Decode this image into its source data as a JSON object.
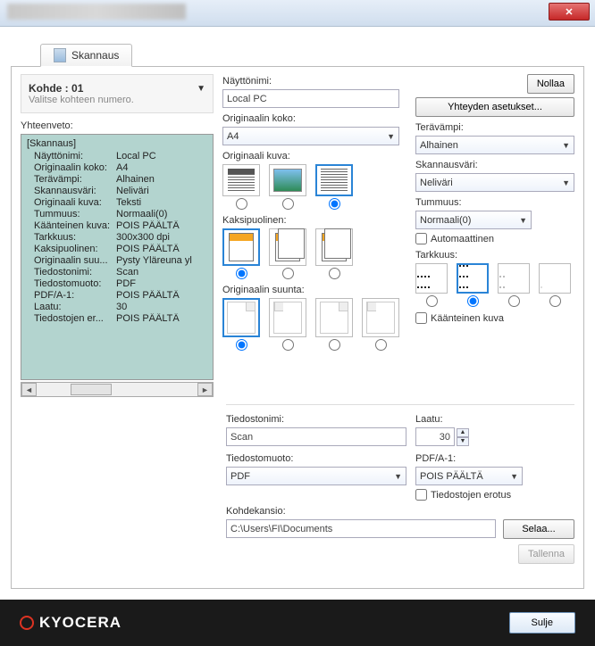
{
  "window": {
    "close_label": "✕"
  },
  "tab": {
    "label": "Skannaus"
  },
  "kohde": {
    "label": "Kohde :",
    "value": "01",
    "hint": "Valitse kohteen numero."
  },
  "summary": {
    "label": "Yhteenveto:",
    "header": "[Skannaus]",
    "rows": [
      {
        "key": "Näyttönimi:",
        "val": "Local PC"
      },
      {
        "key": "Originaalin koko:",
        "val": "A4"
      },
      {
        "key": "Terävämpi:",
        "val": "Alhainen"
      },
      {
        "key": "Skannausväri:",
        "val": "Neliväri"
      },
      {
        "key": "Originaali kuva:",
        "val": "Teksti"
      },
      {
        "key": "Tummuus:",
        "val": "Normaali(0)"
      },
      {
        "key": "Käänteinen kuva:",
        "val": "POIS PÄÄLTÄ"
      },
      {
        "key": "Tarkkuus:",
        "val": "300x300 dpi"
      },
      {
        "key": "Kaksipuolinen:",
        "val": "POIS PÄÄLTÄ"
      },
      {
        "key": "Originaalin suu...",
        "val": "Pysty Yläreuna yl"
      },
      {
        "key": "Tiedostonimi:",
        "val": "Scan"
      },
      {
        "key": "Tiedostomuoto:",
        "val": "PDF"
      },
      {
        "key": "PDF/A-1:",
        "val": "POIS PÄÄLTÄ"
      },
      {
        "key": "Laatu:",
        "val": "30"
      },
      {
        "key": "Tiedostojen er...",
        "val": "POIS PÄÄLTÄ"
      }
    ]
  },
  "right": {
    "displayname_label": "Näyttönimi:",
    "displayname_value": "Local PC",
    "reset_label": "Nollaa",
    "connection_label": "Yhteyden asetukset...",
    "origsize_label": "Originaalin koko:",
    "origsize_value": "A4",
    "sharp_label": "Terävämpi:",
    "sharp_value": "Alhainen",
    "color_label": "Skannausväri:",
    "color_value": "Neliväri",
    "density_label": "Tummuus:",
    "density_value": "Normaali(0)",
    "auto_label": "Automaattinen",
    "origimage_label": "Originaali kuva:",
    "duplex_label": "Kaksipuolinen:",
    "orientation_label": "Originaalin suunta:",
    "resolution_label": "Tarkkuus:",
    "invert_label": "Käänteinen kuva",
    "filename_label": "Tiedostonimi:",
    "filename_value": "Scan",
    "quality_label": "Laatu:",
    "quality_value": "30",
    "fileformat_label": "Tiedostomuoto:",
    "fileformat_value": "PDF",
    "pdfa_label": "PDF/A-1:",
    "pdfa_value": "POIS PÄÄLTÄ",
    "filesep_label": "Tiedostojen erotus",
    "folder_label": "Kohdekansio:",
    "folder_value": "C:\\Users\\FI\\Documents",
    "browse_label": "Selaa...",
    "save_label": "Tallenna"
  },
  "footer": {
    "brand": "KYOCERA",
    "close": "Sulje"
  }
}
